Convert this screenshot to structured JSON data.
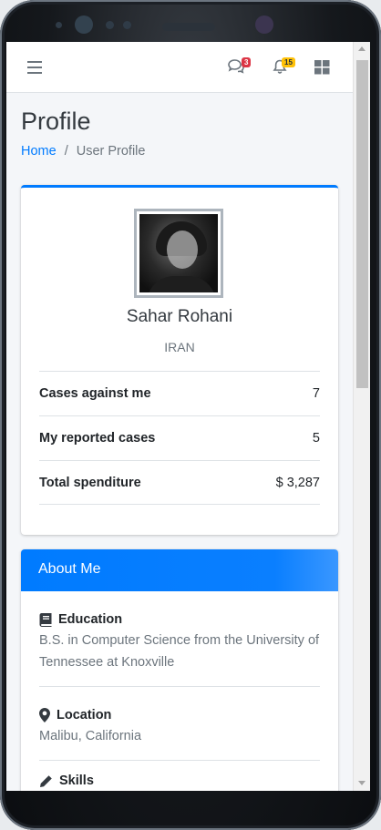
{
  "navbar": {
    "messages_badge": "3",
    "notifications_badge": "15"
  },
  "header": {
    "title": "Profile",
    "breadcrumb_home": "Home",
    "breadcrumb_separator": "/",
    "breadcrumb_current": "User Profile"
  },
  "profile": {
    "name": "Sahar Rohani",
    "country": "IRAN",
    "stats": [
      {
        "label": "Cases against me",
        "value": "7"
      },
      {
        "label": "My reported cases",
        "value": "5"
      },
      {
        "label": "Total spenditure",
        "value": "$ 3,287"
      }
    ]
  },
  "about": {
    "title": "About Me",
    "education": {
      "label": "Education",
      "text": "B.S. in Computer Science from the University of Tennessee at Knoxville"
    },
    "location": {
      "label": "Location",
      "text": "Malibu, California"
    },
    "skills": {
      "label": "Skills"
    }
  },
  "colors": {
    "primary": "#007bff",
    "danger": "#dc3545",
    "warning": "#ffc107",
    "muted": "#6c757d",
    "background": "#f4f6f9"
  },
  "icons": [
    "bars-icon",
    "comments-icon",
    "bell-icon",
    "grid-icon",
    "book-icon",
    "map-marker-icon",
    "pencil-icon"
  ]
}
